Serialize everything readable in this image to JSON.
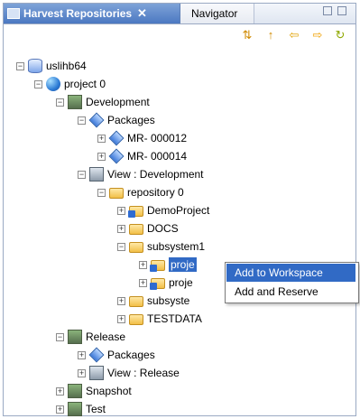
{
  "tabs": {
    "active": "Harvest Repositories",
    "active_close": "✕",
    "inactive": "Navigator"
  },
  "toolbar": {
    "buttons": [
      "sync-icon",
      "up-arrow-icon",
      "back-arrow-icon",
      "forward-arrow-icon",
      "refresh-icon"
    ]
  },
  "tree": {
    "root": "uslihb64",
    "project": "project 0",
    "development": "Development",
    "packages": "Packages",
    "mr1": "MR- 000012",
    "mr2": "MR- 000014",
    "view_development": "View : Development",
    "repository": "repository 0",
    "demo_project": "DemoProject",
    "docs": "DOCS",
    "subsystem1": "subsystem1",
    "proj_selected": "proje",
    "proj2": "proje",
    "subsystem2": "subsyste",
    "testdata": "TESTDATA",
    "release": "Release",
    "release_packages": "Packages",
    "view_release": "View : Release",
    "snapshot": "Snapshot",
    "test": "Test"
  },
  "context_menu": {
    "items": [
      "Add to Workspace",
      "Add and Reserve"
    ]
  }
}
